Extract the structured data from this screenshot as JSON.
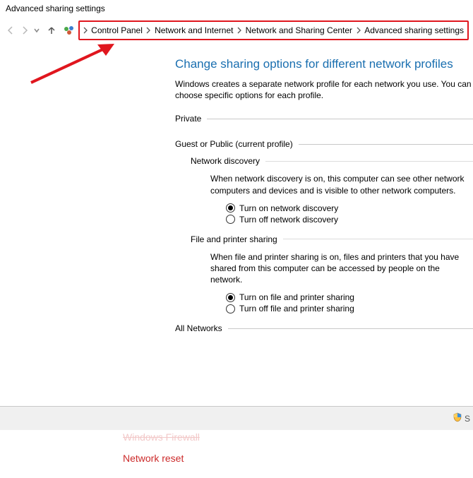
{
  "window": {
    "title": "Advanced sharing settings"
  },
  "breadcrumb": {
    "items": [
      "Control Panel",
      "Network and Internet",
      "Network and Sharing Center",
      "Advanced sharing settings"
    ]
  },
  "main": {
    "heading": "Change sharing options for different network profiles",
    "description": "Windows creates a separate network profile for each network you use. You can choose specific options for each profile.",
    "private": {
      "label": "Private"
    },
    "guest": {
      "label": "Guest or Public (current profile)",
      "discovery": {
        "label": "Network discovery",
        "desc": "When network discovery is on, this computer can see other network computers and devices and is visible to other network computers.",
        "on": "Turn on network discovery",
        "off": "Turn off network discovery"
      },
      "fileprint": {
        "label": "File and printer sharing",
        "desc": "When file and printer sharing is on, files and printers that you have shared from this computer can be accessed by people on the network.",
        "on": "Turn on file and printer sharing",
        "off": "Turn off file and printer sharing"
      }
    },
    "all": {
      "label": "All Networks"
    }
  },
  "bottom": {
    "save_partial": "S"
  },
  "lower": {
    "firewall_cut": "Windows Firewall",
    "reset": "Network reset"
  }
}
